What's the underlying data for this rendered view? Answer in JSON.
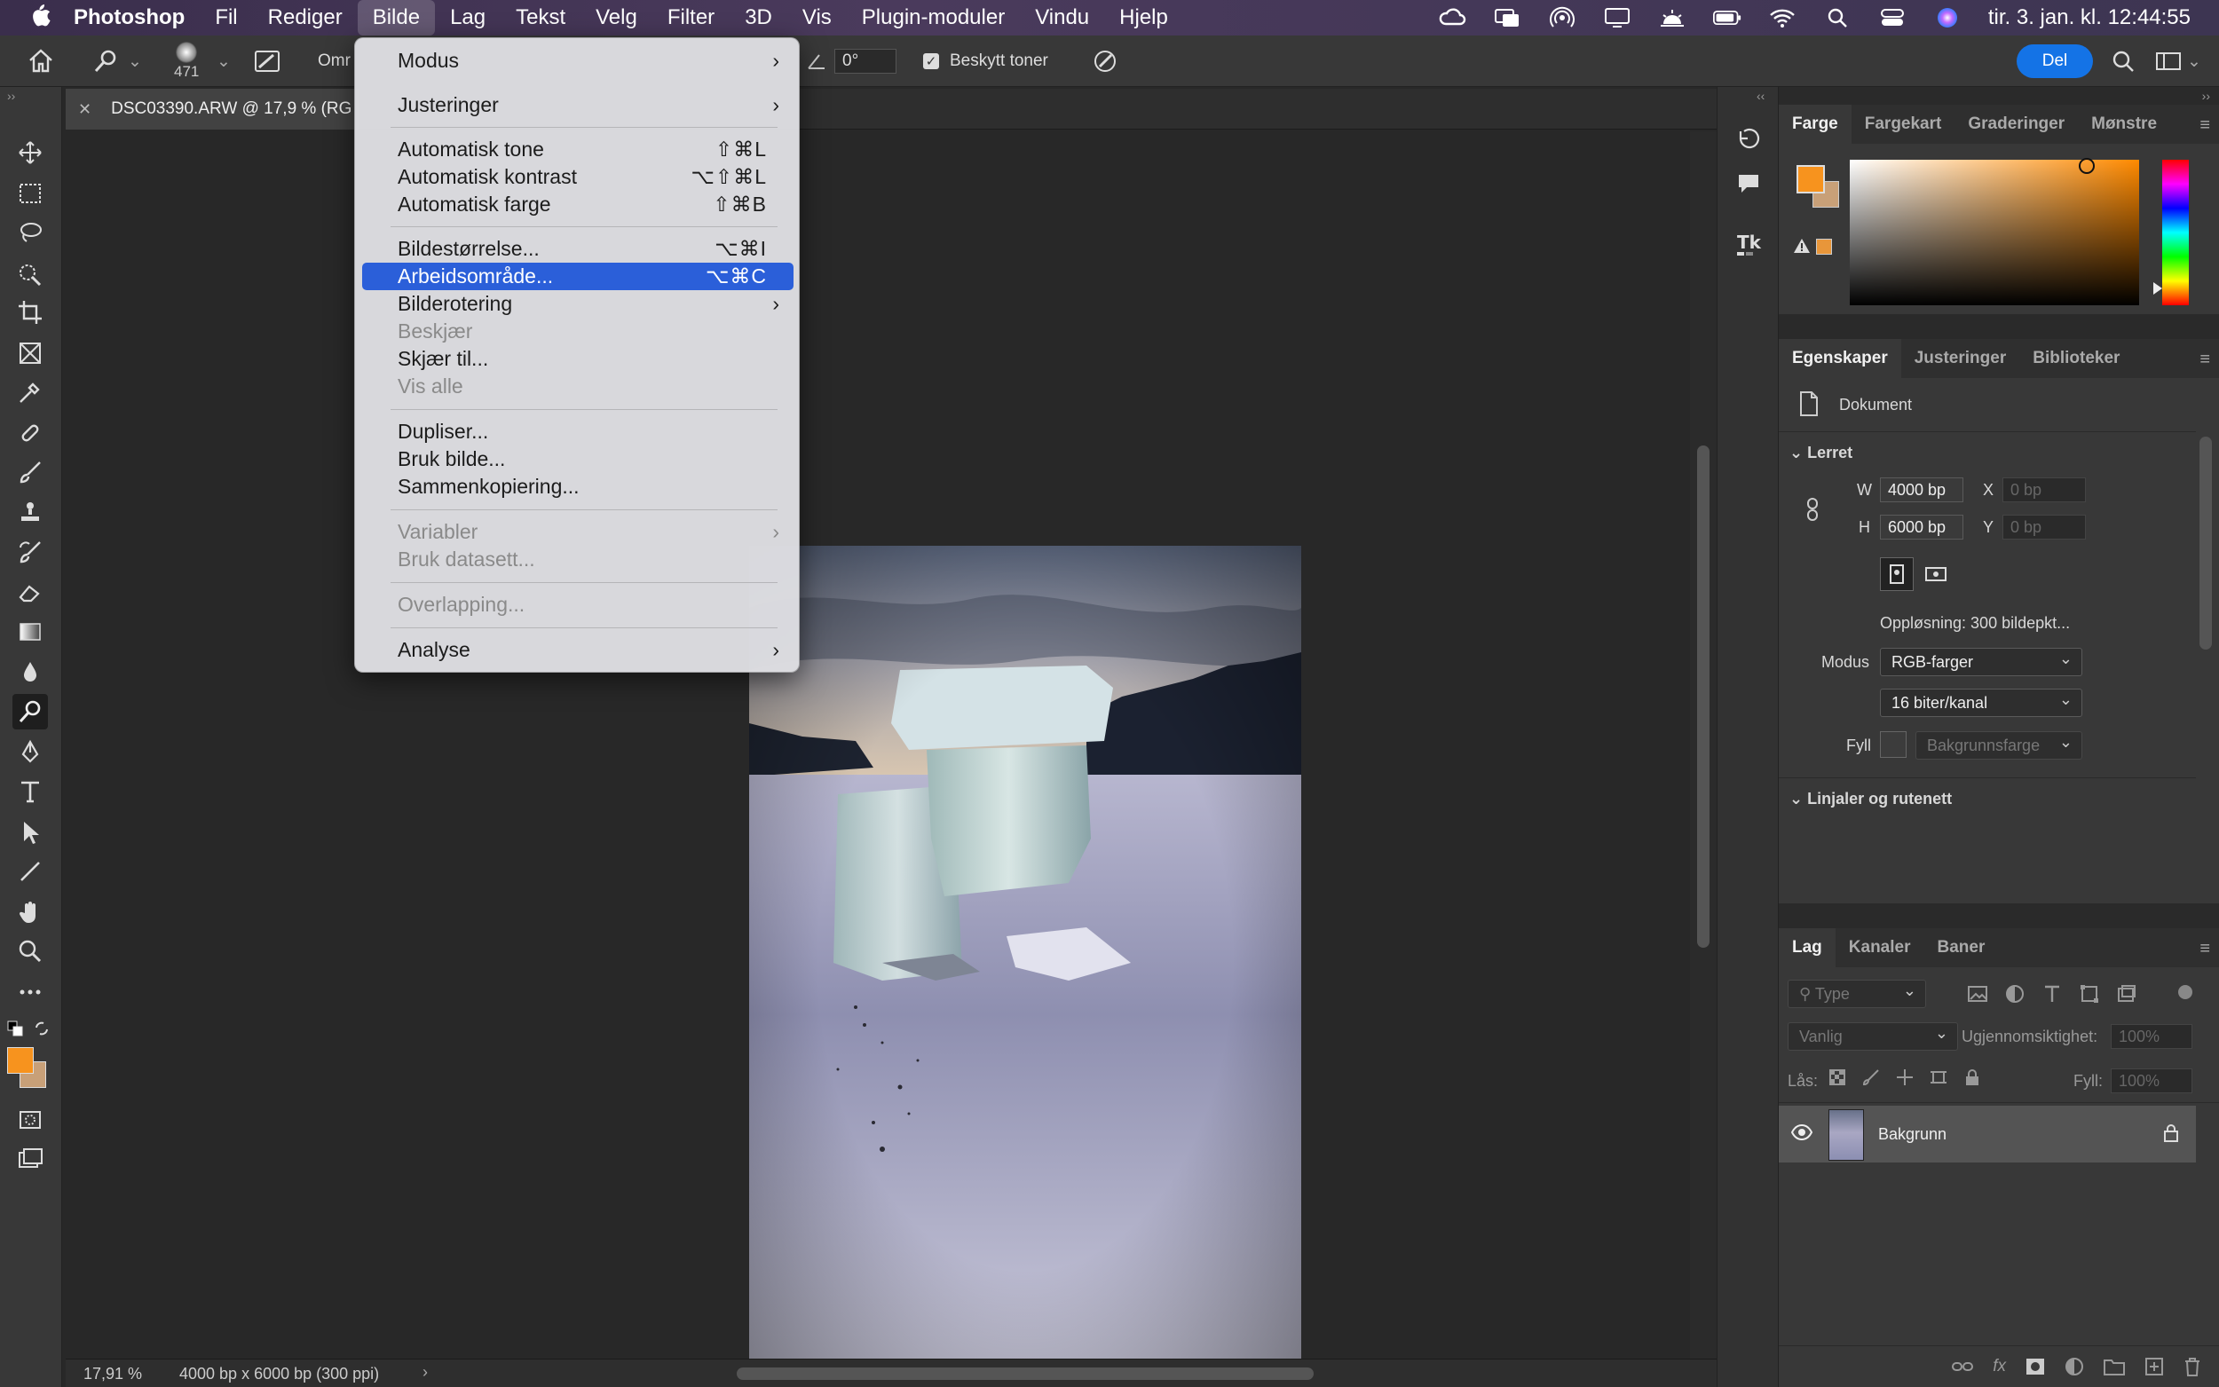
{
  "menubar": {
    "app": "Photoshop",
    "items": [
      "Fil",
      "Rediger",
      "Bilde",
      "Lag",
      "Tekst",
      "Velg",
      "Filter",
      "3D",
      "Vis",
      "Plugin-moduler",
      "Vindu",
      "Hjelp"
    ],
    "active": "Bilde",
    "clock": "tir. 3. jan. kl. 12:44:55"
  },
  "options": {
    "brush_size": "471",
    "mode_prefix": "Omr",
    "angle": "0°",
    "protect_tones": "Beskytt toner",
    "share": "Del"
  },
  "document": {
    "tab_title": "DSC03390.ARW @ 17,9 % (RG",
    "zoom": "17,91 %",
    "info": "4000 bp x 6000 bp (300 ppi)"
  },
  "image_menu": {
    "items": [
      {
        "label": "Modus",
        "submenu": true
      },
      {
        "label": "Justeringer",
        "submenu": true
      },
      {
        "label": "Automatisk tone",
        "shortcut": "⇧⌘L"
      },
      {
        "label": "Automatisk kontrast",
        "shortcut": "⌥⇧⌘L"
      },
      {
        "label": "Automatisk farge",
        "shortcut": "⇧⌘B"
      },
      {
        "label": "Bildestørrelse...",
        "shortcut": "⌥⌘I"
      },
      {
        "label": "Arbeidsområde...",
        "shortcut": "⌥⌘C",
        "highlighted": true
      },
      {
        "label": "Bilderotering",
        "submenu": true
      },
      {
        "label": "Beskjær",
        "disabled": true
      },
      {
        "label": "Skjær til..."
      },
      {
        "label": "Vis alle",
        "disabled": true
      },
      {
        "label": "Dupliser..."
      },
      {
        "label": "Bruk bilde..."
      },
      {
        "label": "Sammenkopiering..."
      },
      {
        "label": "Variabler",
        "submenu": true,
        "disabled": true
      },
      {
        "label": "Bruk datasett...",
        "disabled": true
      },
      {
        "label": "Overlapping...",
        "disabled": true
      },
      {
        "label": "Analyse",
        "submenu": true
      }
    ]
  },
  "color_panel": {
    "tabs": [
      "Farge",
      "Fargekart",
      "Graderinger",
      "Mønstre"
    ],
    "foreground": "#f7931e",
    "background": "#c8a078"
  },
  "properties_panel": {
    "tabs": [
      "Egenskaper",
      "Justeringer",
      "Biblioteker"
    ],
    "doc_label": "Dokument",
    "canvas_section": "Lerret",
    "w_label": "W",
    "w_value": "4000 bp",
    "h_label": "H",
    "h_value": "6000 bp",
    "x_label": "X",
    "x_placeholder": "0 bp",
    "y_label": "Y",
    "y_placeholder": "0 bp",
    "resolution": "Oppløsning: 300 bildepkt...",
    "mode_label": "Modus",
    "mode_value": "RGB-farger",
    "depth_value": "16 biter/kanal",
    "fill_label": "Fyll",
    "fill_value": "Bakgrunnsfarge",
    "rulers_section": "Linjaler og rutenett"
  },
  "layers_panel": {
    "tabs": [
      "Lag",
      "Kanaler",
      "Baner"
    ],
    "filter_placeholder": "Type",
    "blend_mode": "Vanlig",
    "opacity_label": "Ugjennomsiktighet:",
    "opacity_value": "100%",
    "lock_label": "Lås:",
    "fill_label": "Fyll:",
    "fill_value": "100%",
    "layers": [
      {
        "name": "Bakgrunn",
        "visible": true,
        "locked": true
      }
    ]
  }
}
